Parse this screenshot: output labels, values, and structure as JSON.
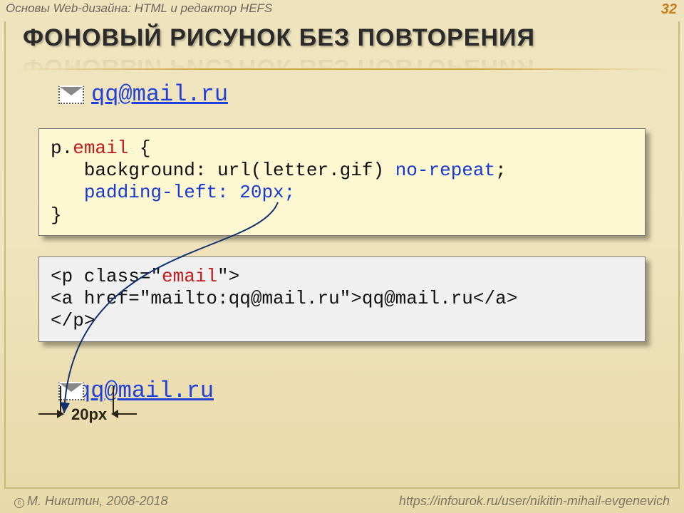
{
  "slide": {
    "course": "Основы Web-дизайна: HTML и редактор HEFS",
    "number": "32",
    "title": "ФОНОВЫЙ РИСУНОК БЕЗ ПОВТОРЕНИЯ"
  },
  "demo": {
    "email": "qq@mail.ru",
    "email2": "qq@mail.ru"
  },
  "css_code": {
    "l1a": "p.",
    "l1b": "email",
    "l1c": " {",
    "l2a": "   background: url(letter.gif) ",
    "l2b": "no-repeat",
    "l2c": ";",
    "l3a": "   ",
    "l3b": "padding-left: 20px;",
    "l4": "}"
  },
  "html_code": {
    "l1a": "<p class=\"",
    "l1b": "email",
    "l1c": "\">",
    "l2": "<a href=\"mailto:qq@mail.ru\">qq@mail.ru</a>",
    "l3": "</p>"
  },
  "measure": {
    "label": "20px"
  },
  "footer": {
    "left": "М. Никитин, 2008-2018",
    "right": "https://infourok.ru/user/nikitin-mihail-evgenevich"
  }
}
